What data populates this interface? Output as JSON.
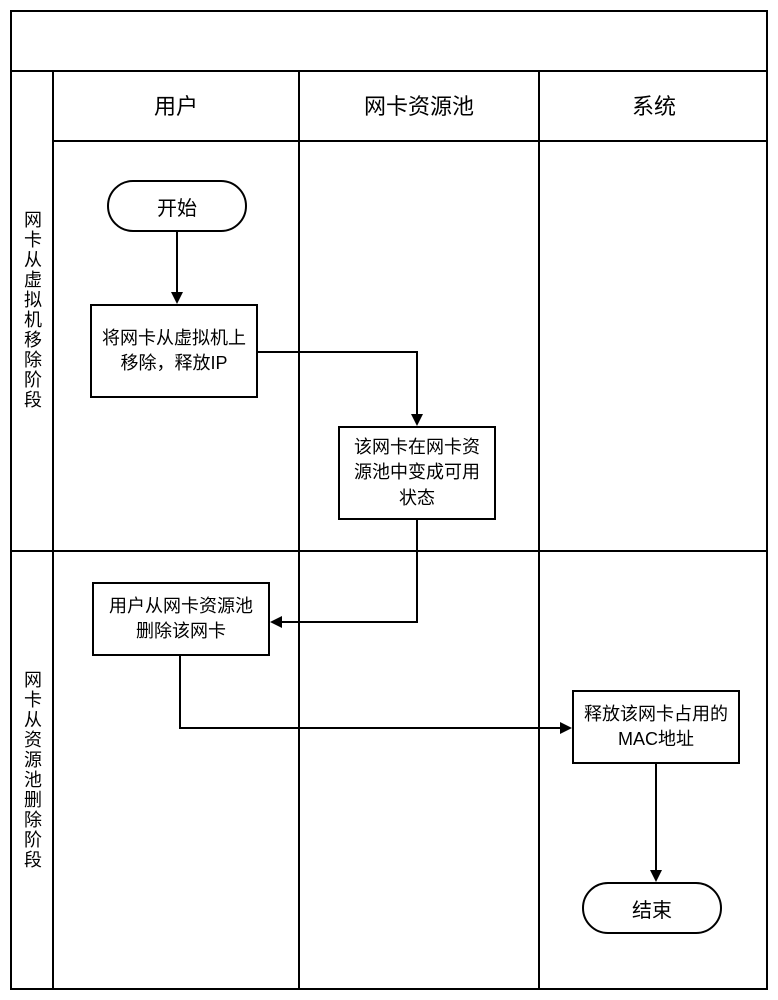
{
  "columns": {
    "user": "用户",
    "pool": "网卡资源池",
    "system": "系统"
  },
  "phases": {
    "phase1": "网卡从虚拟机移除阶段",
    "phase2": "网卡从资源池删除阶段"
  },
  "nodes": {
    "start": "开始",
    "remove_from_vm": "将网卡从虚拟机上移除，释放IP",
    "pool_available": "该网卡在网卡资源池中变成可用状态",
    "user_delete": "用户从网卡资源池删除该网卡",
    "release_mac": "释放该网卡占用的MAC地址",
    "end": "结束"
  },
  "chart_data": {
    "type": "swimlane-flowchart",
    "lanes": [
      "用户",
      "网卡资源池",
      "系统"
    ],
    "phases": [
      "网卡从虚拟机移除阶段",
      "网卡从资源池删除阶段"
    ],
    "nodes": [
      {
        "id": "start",
        "lane": "用户",
        "phase": 0,
        "type": "terminator",
        "label": "开始"
      },
      {
        "id": "remove_from_vm",
        "lane": "用户",
        "phase": 0,
        "type": "process",
        "label": "将网卡从虚拟机上移除，释放IP"
      },
      {
        "id": "pool_available",
        "lane": "网卡资源池",
        "phase": 0,
        "type": "process",
        "label": "该网卡在网卡资源池中变成可用状态"
      },
      {
        "id": "user_delete",
        "lane": "用户",
        "phase": 1,
        "type": "process",
        "label": "用户从网卡资源池删除该网卡"
      },
      {
        "id": "release_mac",
        "lane": "系统",
        "phase": 1,
        "type": "process",
        "label": "释放该网卡占用的MAC地址"
      },
      {
        "id": "end",
        "lane": "系统",
        "phase": 1,
        "type": "terminator",
        "label": "结束"
      }
    ],
    "edges": [
      {
        "from": "start",
        "to": "remove_from_vm"
      },
      {
        "from": "remove_from_vm",
        "to": "pool_available"
      },
      {
        "from": "pool_available",
        "to": "user_delete"
      },
      {
        "from": "user_delete",
        "to": "release_mac"
      },
      {
        "from": "release_mac",
        "to": "end"
      }
    ]
  }
}
